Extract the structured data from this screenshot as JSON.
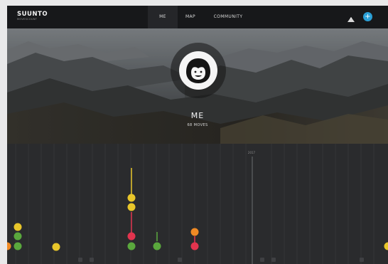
{
  "brand": {
    "name": "SUUNTO",
    "tagline": "MOVESCOUNT"
  },
  "nav": {
    "me": "ME",
    "map": "MAP",
    "community": "COMMUNITY"
  },
  "header_icons": [
    "mountain-icon",
    "add-icon"
  ],
  "profile": {
    "title": "ME",
    "moves": "68 MOVES"
  },
  "timeline": {
    "today_label": "2017"
  },
  "colors": {
    "yellow": "#e8c62a",
    "green": "#5aa83d",
    "red": "#e2344e",
    "orange": "#f08a24",
    "accent": "#2a9fd6"
  }
}
